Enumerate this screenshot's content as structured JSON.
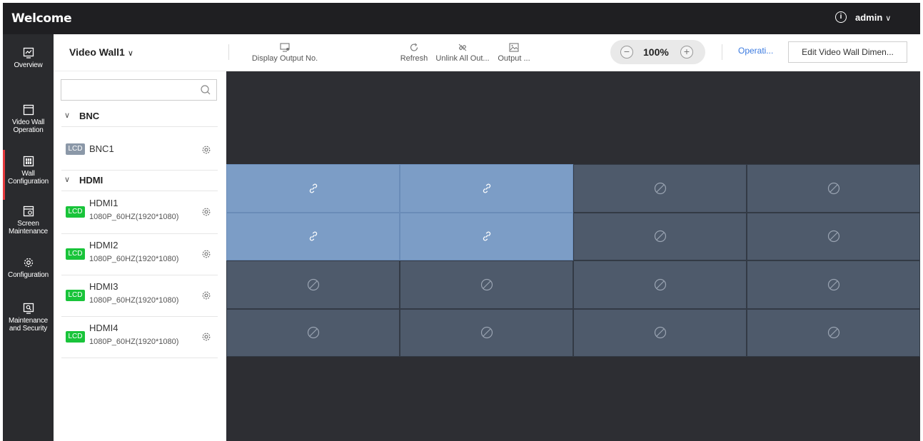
{
  "header": {
    "title": "Welcome",
    "user": "admin"
  },
  "nav": [
    {
      "label_lines": [
        "Overview"
      ],
      "icon": "overview-icon"
    },
    {
      "label_lines": [
        "Video Wall",
        "Operation"
      ],
      "icon": "video-wall-icon"
    },
    {
      "label_lines": [
        "Wall",
        "Configuration"
      ],
      "icon": "wall-config-icon",
      "active": true
    },
    {
      "label_lines": [
        "Screen",
        "Maintenance"
      ],
      "icon": "screen-maintenance-icon"
    },
    {
      "label_lines": [
        "Configuration"
      ],
      "icon": "gear-icon"
    },
    {
      "label_lines": [
        "Maintenance",
        "and Security"
      ],
      "icon": "maintenance-security-icon"
    }
  ],
  "panel": {
    "wall_name": "Video Wall1",
    "search_placeholder": "",
    "groups": [
      {
        "name": "BNC",
        "outputs": [
          {
            "badge": "LCD",
            "name": "BNC1",
            "resolution": "",
            "linked": false
          }
        ]
      },
      {
        "name": "HDMI",
        "outputs": [
          {
            "badge": "LCD",
            "name": "HDMI1",
            "resolution": "1080P_60HZ(1920*1080)",
            "linked": true
          },
          {
            "badge": "LCD",
            "name": "HDMI2",
            "resolution": "1080P_60HZ(1920*1080)",
            "linked": true
          },
          {
            "badge": "LCD",
            "name": "HDMI3",
            "resolution": "1080P_60HZ(1920*1080)",
            "linked": true
          },
          {
            "badge": "LCD",
            "name": "HDMI4",
            "resolution": "1080P_60HZ(1920*1080)",
            "linked": true
          }
        ]
      }
    ]
  },
  "toolbar": {
    "display_output": "Display Output No.",
    "refresh": "Refresh",
    "unlink_all": "Unlink All Out...",
    "output": "Output ...",
    "zoom": "100%",
    "operation": "Operati...",
    "edit_dimension": "Edit Video Wall Dimen..."
  },
  "wall": {
    "rows": 4,
    "cols": 4,
    "cells": [
      [
        "linked",
        "linked",
        "unlinked",
        "unlinked"
      ],
      [
        "linked",
        "linked",
        "unlinked",
        "unlinked"
      ],
      [
        "unlinked",
        "unlinked",
        "unlinked",
        "unlinked"
      ],
      [
        "unlinked",
        "unlinked",
        "unlinked",
        "unlinked"
      ]
    ]
  },
  "colors": {
    "linked": "#7c9dc6",
    "unlinked": "#4e5a6b",
    "badge_green": "#19c43a",
    "badge_grey": "#8b98a8",
    "active_accent": "#e5393d",
    "link_blue": "#3c7be0"
  }
}
